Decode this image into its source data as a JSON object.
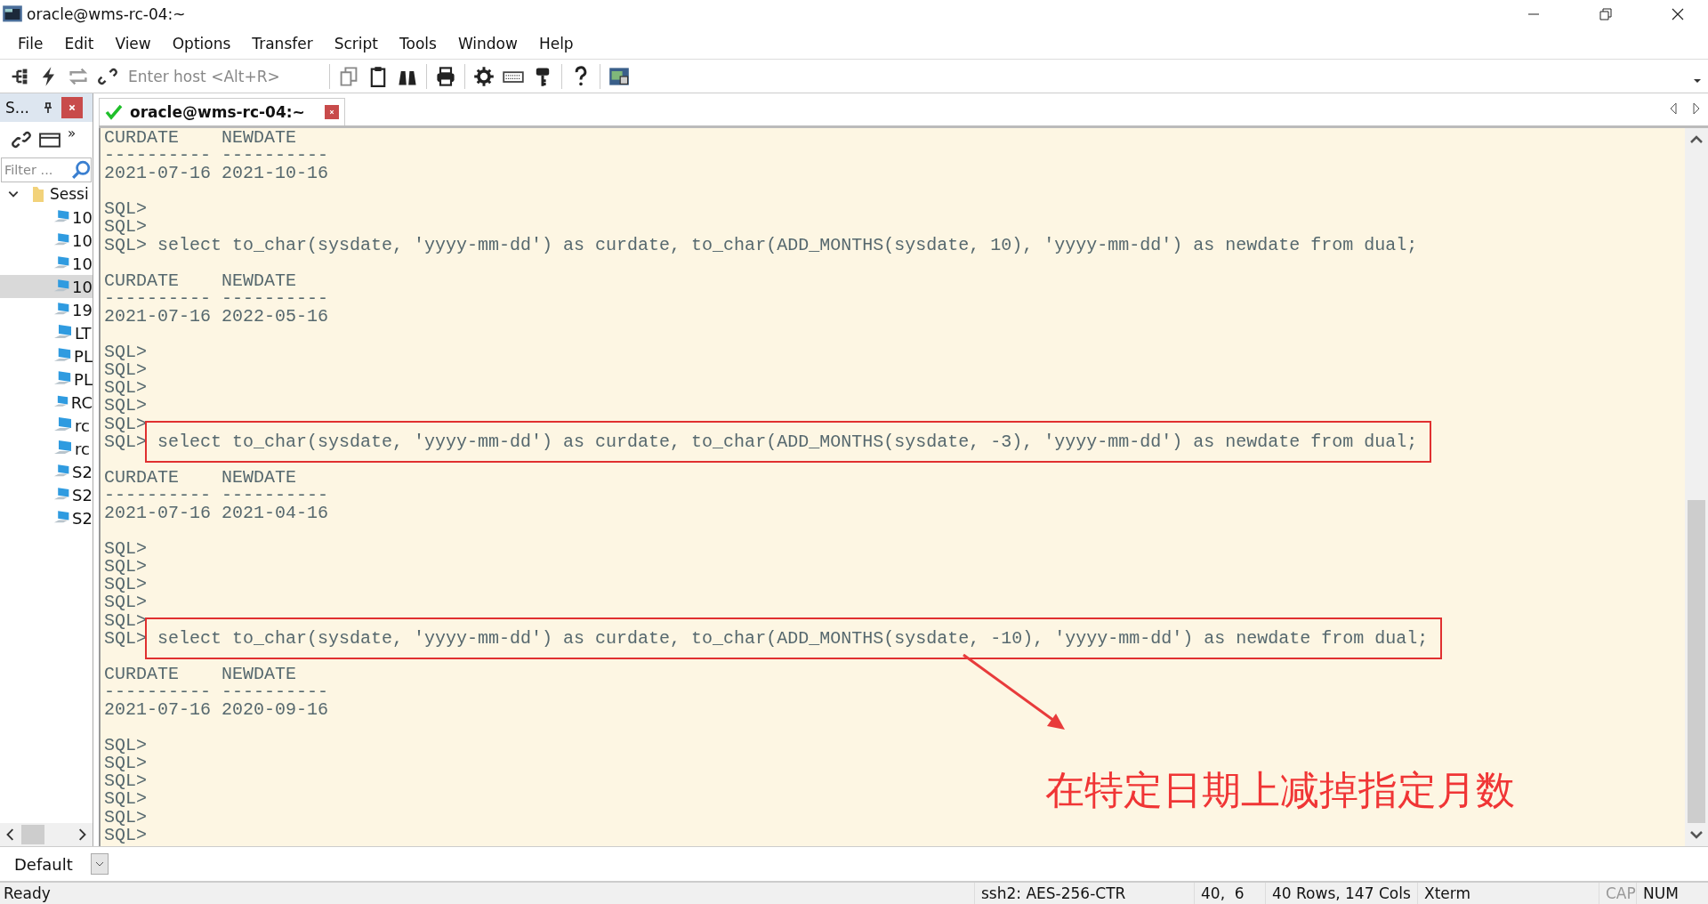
{
  "window": {
    "title": "oracle@wms-rc-04:~"
  },
  "menu": [
    "File",
    "Edit",
    "View",
    "Options",
    "Transfer",
    "Script",
    "Tools",
    "Window",
    "Help"
  ],
  "toolbar": {
    "host_field": {
      "placeholder": "Enter host <Alt+R>"
    }
  },
  "sidebar": {
    "title": "S...",
    "more": "»",
    "filter": {
      "placeholder": "Filter ..."
    },
    "tree": [
      {
        "label": "Sessi",
        "expanded": true,
        "children": [
          {
            "label": "10",
            "selected": false
          },
          {
            "label": "10",
            "selected": false
          },
          {
            "label": "10",
            "selected": false
          },
          {
            "label": "10",
            "selected": true
          },
          {
            "label": "19",
            "selected": false
          },
          {
            "label": "LT",
            "selected": false
          },
          {
            "label": "PL",
            "selected": false
          },
          {
            "label": "PL",
            "selected": false
          },
          {
            "label": "RC",
            "selected": false
          },
          {
            "label": "rc",
            "selected": false
          },
          {
            "label": "rc",
            "selected": false
          },
          {
            "label": "S2",
            "selected": false
          },
          {
            "label": "S2",
            "selected": false
          },
          {
            "label": "S2",
            "selected": false
          }
        ]
      }
    ]
  },
  "tab": {
    "title": "oracle@wms-rc-04:~",
    "connected": true
  },
  "terminal": {
    "lines": [
      {
        "kind": "output",
        "text": "CURDATE    NEWDATE"
      },
      {
        "kind": "output",
        "text": "---------- ----------"
      },
      {
        "kind": "output",
        "text": "2021-07-16 2021-10-16"
      },
      {
        "kind": "blank"
      },
      {
        "kind": "prompt",
        "prompt": "SQL>"
      },
      {
        "kind": "prompt",
        "prompt": "SQL>"
      },
      {
        "kind": "prompt",
        "prompt": "SQL>",
        "command": "select to_char(sysdate, 'yyyy-mm-dd') as curdate, to_char(ADD_MONTHS(sysdate, 10), 'yyyy-mm-dd') as newdate from dual;",
        "highlighted": false
      },
      {
        "kind": "blank"
      },
      {
        "kind": "output",
        "text": "CURDATE    NEWDATE"
      },
      {
        "kind": "output",
        "text": "---------- ----------"
      },
      {
        "kind": "output",
        "text": "2021-07-16 2022-05-16"
      },
      {
        "kind": "blank"
      },
      {
        "kind": "prompt",
        "prompt": "SQL>"
      },
      {
        "kind": "prompt",
        "prompt": "SQL>"
      },
      {
        "kind": "prompt",
        "prompt": "SQL>"
      },
      {
        "kind": "prompt",
        "prompt": "SQL>"
      },
      {
        "kind": "prompt",
        "prompt": "SQL>"
      },
      {
        "kind": "prompt",
        "prompt": "SQL>",
        "command": "select to_char(sysdate, 'yyyy-mm-dd') as curdate, to_char(ADD_MONTHS(sysdate, -3), 'yyyy-mm-dd') as newdate from dual;",
        "highlighted": true
      },
      {
        "kind": "blank"
      },
      {
        "kind": "output",
        "text": "CURDATE    NEWDATE"
      },
      {
        "kind": "output",
        "text": "---------- ----------"
      },
      {
        "kind": "output",
        "text": "2021-07-16 2021-04-16"
      },
      {
        "kind": "blank"
      },
      {
        "kind": "prompt",
        "prompt": "SQL>"
      },
      {
        "kind": "prompt",
        "prompt": "SQL>"
      },
      {
        "kind": "prompt",
        "prompt": "SQL>"
      },
      {
        "kind": "prompt",
        "prompt": "SQL>"
      },
      {
        "kind": "prompt",
        "prompt": "SQL>"
      },
      {
        "kind": "prompt",
        "prompt": "SQL>",
        "command": "select to_char(sysdate, 'yyyy-mm-dd') as curdate, to_char(ADD_MONTHS(sysdate, -10), 'yyyy-mm-dd') as newdate from dual;",
        "highlighted": true
      },
      {
        "kind": "blank"
      },
      {
        "kind": "output",
        "text": "CURDATE    NEWDATE"
      },
      {
        "kind": "output",
        "text": "---------- ----------"
      },
      {
        "kind": "output",
        "text": "2021-07-16 2020-09-16"
      },
      {
        "kind": "blank"
      },
      {
        "kind": "prompt",
        "prompt": "SQL>"
      },
      {
        "kind": "prompt",
        "prompt": "SQL>"
      },
      {
        "kind": "prompt",
        "prompt": "SQL>"
      },
      {
        "kind": "prompt",
        "prompt": "SQL>"
      },
      {
        "kind": "prompt",
        "prompt": "SQL>"
      },
      {
        "kind": "prompt",
        "prompt": "SQL>"
      }
    ]
  },
  "annotation": {
    "text": "在特定日期上减掉指定月数"
  },
  "session_bar": {
    "value": "Default"
  },
  "status_bar": {
    "items": [
      {
        "text": "Ready",
        "disabled": false
      },
      {
        "text": "ssh2: AES-256-CTR",
        "disabled": false
      },
      {
        "text": "40,  6",
        "disabled": false
      },
      {
        "text": "40 Rows, 147 Cols",
        "disabled": false
      },
      {
        "text": "Xterm",
        "disabled": false
      },
      {
        "text": "CAP",
        "disabled": true
      },
      {
        "text": "NUM",
        "disabled": false
      }
    ]
  }
}
